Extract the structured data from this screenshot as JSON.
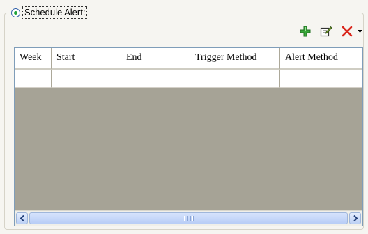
{
  "schedule_alert": {
    "label": "Schedule Alert:",
    "radio_selected": true
  },
  "toolbar": {
    "buttons": [
      {
        "icon": "add-icon",
        "color": "#2f9e2f"
      },
      {
        "icon": "edit-icon",
        "color": "#4a7a2a"
      },
      {
        "icon": "delete-icon",
        "color": "#d9261c"
      },
      {
        "icon": "dropdown-arrow-icon",
        "color": "#000000"
      }
    ]
  },
  "grid": {
    "columns": [
      "Week",
      "Start",
      "End",
      "Trigger Method",
      "Alert Method"
    ],
    "rows": [
      [
        "",
        "",
        "",
        "",
        ""
      ]
    ],
    "empty_area_color": "#a6a396"
  },
  "scrollbar": {
    "orientation": "horizontal"
  }
}
